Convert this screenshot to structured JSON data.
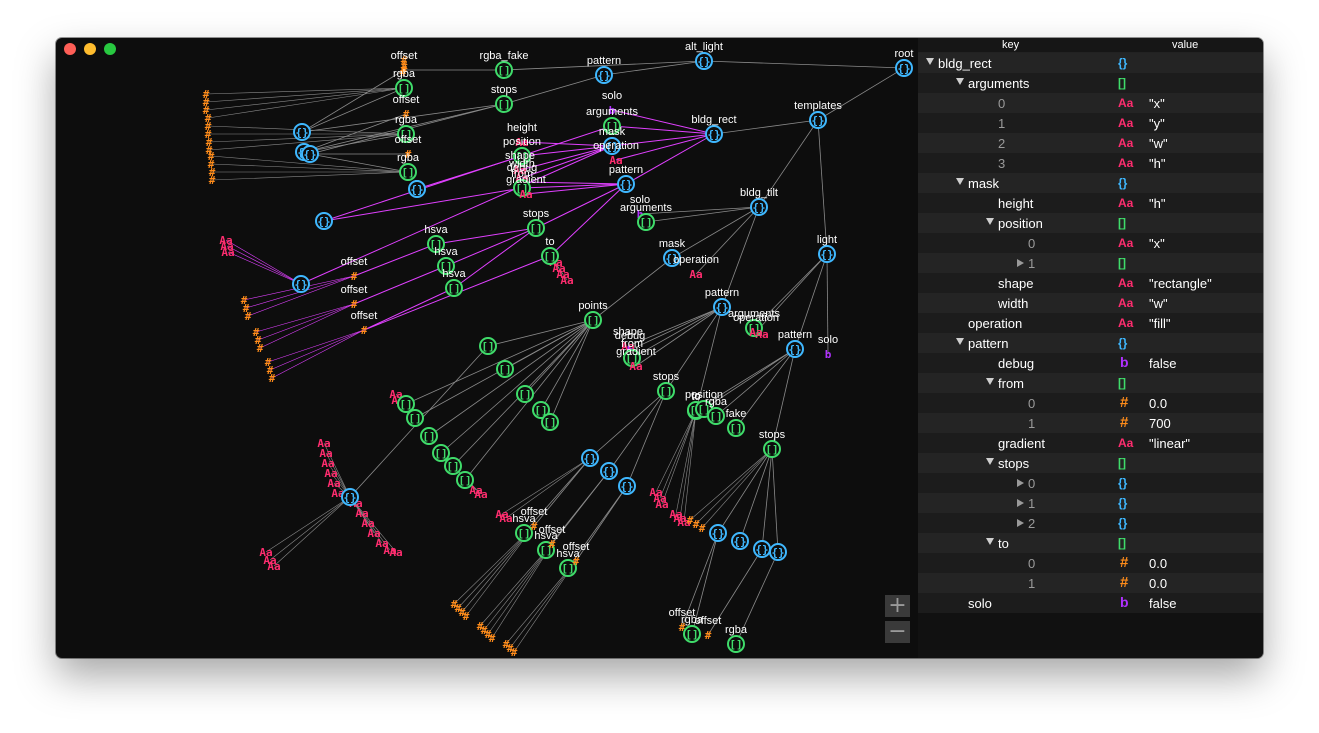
{
  "colors": {
    "object": "#3fb8ff",
    "array": "#3fdc6a",
    "string": "#ff2d6f",
    "number": "#ff8c1a",
    "boolean": "#b030ff",
    "edge": "#8a8a8a",
    "highlight_edge": "#e040ff"
  },
  "zoom": {
    "in_label": "+",
    "out_label": "−"
  },
  "inspector": {
    "key_header": "key",
    "value_header": "value",
    "rows": [
      {
        "key": "bldg_rect",
        "depth": 0,
        "toggle": "open",
        "type": "object",
        "value": ""
      },
      {
        "key": "arguments",
        "depth": 1,
        "toggle": "open",
        "type": "array",
        "value": ""
      },
      {
        "key": "0",
        "depth": 2,
        "toggle": "none",
        "type": "string",
        "value": "\"x\"",
        "index": true
      },
      {
        "key": "1",
        "depth": 2,
        "toggle": "none",
        "type": "string",
        "value": "\"y\"",
        "index": true
      },
      {
        "key": "2",
        "depth": 2,
        "toggle": "none",
        "type": "string",
        "value": "\"w\"",
        "index": true
      },
      {
        "key": "3",
        "depth": 2,
        "toggle": "none",
        "type": "string",
        "value": "\"h\"",
        "index": true
      },
      {
        "key": "mask",
        "depth": 1,
        "toggle": "open",
        "type": "object",
        "value": ""
      },
      {
        "key": "height",
        "depth": 2,
        "toggle": "none",
        "type": "string",
        "value": "\"h\""
      },
      {
        "key": "position",
        "depth": 2,
        "toggle": "open",
        "type": "array",
        "value": ""
      },
      {
        "key": "0",
        "depth": 3,
        "toggle": "none",
        "type": "string",
        "value": "\"x\"",
        "index": true
      },
      {
        "key": "1",
        "depth": 3,
        "toggle": "closed",
        "type": "array",
        "value": "",
        "index": true
      },
      {
        "key": "shape",
        "depth": 2,
        "toggle": "none",
        "type": "string",
        "value": "\"rectangle\""
      },
      {
        "key": "width",
        "depth": 2,
        "toggle": "none",
        "type": "string",
        "value": "\"w\""
      },
      {
        "key": "operation",
        "depth": 1,
        "toggle": "none",
        "type": "string",
        "value": "\"fill\""
      },
      {
        "key": "pattern",
        "depth": 1,
        "toggle": "open",
        "type": "object",
        "value": ""
      },
      {
        "key": "debug",
        "depth": 2,
        "toggle": "none",
        "type": "boolean",
        "value": "false"
      },
      {
        "key": "from",
        "depth": 2,
        "toggle": "open",
        "type": "array",
        "value": ""
      },
      {
        "key": "0",
        "depth": 3,
        "toggle": "none",
        "type": "number",
        "value": "0.0",
        "index": true
      },
      {
        "key": "1",
        "depth": 3,
        "toggle": "none",
        "type": "number",
        "value": "700",
        "index": true
      },
      {
        "key": "gradient",
        "depth": 2,
        "toggle": "none",
        "type": "string",
        "value": "\"linear\""
      },
      {
        "key": "stops",
        "depth": 2,
        "toggle": "open",
        "type": "array",
        "value": ""
      },
      {
        "key": "0",
        "depth": 3,
        "toggle": "closed",
        "type": "object",
        "value": "",
        "index": true
      },
      {
        "key": "1",
        "depth": 3,
        "toggle": "closed",
        "type": "object",
        "value": "",
        "index": true
      },
      {
        "key": "2",
        "depth": 3,
        "toggle": "closed",
        "type": "object",
        "value": "",
        "index": true
      },
      {
        "key": "to",
        "depth": 2,
        "toggle": "open",
        "type": "array",
        "value": ""
      },
      {
        "key": "0",
        "depth": 3,
        "toggle": "none",
        "type": "number",
        "value": "0.0",
        "index": true
      },
      {
        "key": "1",
        "depth": 3,
        "toggle": "none",
        "type": "number",
        "value": "0.0",
        "index": true
      },
      {
        "key": "solo",
        "depth": 1,
        "toggle": "none",
        "type": "boolean",
        "value": "false"
      }
    ]
  },
  "type_glyphs": {
    "object": "{}",
    "array": "[]",
    "string": "Aa",
    "number": "#",
    "boolean": "b"
  },
  "graph": {
    "nodes": [
      {
        "id": "root",
        "label": "root",
        "type": "object"
      },
      {
        "id": "templates",
        "label": "templates",
        "type": "object"
      },
      {
        "id": "alt_light",
        "label": "alt_light",
        "type": "object"
      },
      {
        "id": "bldg_rect",
        "label": "bldg_rect",
        "type": "object"
      },
      {
        "id": "bldg_tilt",
        "label": "bldg_tilt",
        "type": "object"
      },
      {
        "id": "light",
        "label": "light",
        "type": "object"
      },
      {
        "id": "p_top",
        "label": "pattern",
        "type": "object"
      },
      {
        "id": "stops_top",
        "label": "stops",
        "type": "array"
      },
      {
        "id": "rgba_fake",
        "label": "rgba_fake",
        "type": "array"
      },
      {
        "id": "offset_a",
        "label": "offset",
        "type": "number"
      },
      {
        "id": "rgba_a",
        "label": "rgba",
        "type": "array"
      },
      {
        "id": "offset_b",
        "label": "offset",
        "type": "number"
      },
      {
        "id": "rgba_b",
        "label": "rgba",
        "type": "array"
      },
      {
        "id": "offset_c",
        "label": "offset",
        "type": "number"
      },
      {
        "id": "rgba_c",
        "label": "rgba",
        "type": "array"
      },
      {
        "id": "s0",
        "label": "",
        "type": "object"
      },
      {
        "id": "s1",
        "label": "",
        "type": "object"
      },
      {
        "id": "s2",
        "label": "",
        "type": "object"
      },
      {
        "id": "solo_r",
        "label": "solo",
        "type": "boolean"
      },
      {
        "id": "args_r",
        "label": "arguments",
        "type": "array"
      },
      {
        "id": "mask_r",
        "label": "mask",
        "type": "object"
      },
      {
        "id": "operation_r",
        "label": "operation",
        "type": "string"
      },
      {
        "id": "height_r",
        "label": "height",
        "type": "string"
      },
      {
        "id": "position_r",
        "label": "position",
        "type": "array"
      },
      {
        "id": "shape_r",
        "label": "shape",
        "type": "string"
      },
      {
        "id": "width_r",
        "label": "width",
        "type": "string"
      },
      {
        "id": "debug_r",
        "label": "debug",
        "type": "boolean"
      },
      {
        "id": "from_r",
        "label": "from",
        "type": "array"
      },
      {
        "id": "gradient_r",
        "label": "gradient",
        "type": "string"
      },
      {
        "id": "pattern_r",
        "label": "pattern",
        "type": "object"
      },
      {
        "id": "stops_r",
        "label": "stops",
        "type": "array"
      },
      {
        "id": "to_r",
        "label": "to",
        "type": "array"
      },
      {
        "id": "rs0",
        "label": "",
        "type": "object"
      },
      {
        "id": "rs1",
        "label": "",
        "type": "object"
      },
      {
        "id": "rs2",
        "label": "",
        "type": "object"
      },
      {
        "id": "hsva_1",
        "label": "hsva",
        "type": "array"
      },
      {
        "id": "offset_1",
        "label": "offset",
        "type": "number"
      },
      {
        "id": "hsva_2",
        "label": "hsva",
        "type": "array"
      },
      {
        "id": "offset_2",
        "label": "offset",
        "type": "number"
      },
      {
        "id": "hsva_3",
        "label": "hsva",
        "type": "array"
      },
      {
        "id": "offset_3",
        "label": "offset",
        "type": "number"
      },
      {
        "id": "solo_t",
        "label": "solo",
        "type": "boolean"
      },
      {
        "id": "args_t",
        "label": "arguments",
        "type": "array"
      },
      {
        "id": "mask_t",
        "label": "mask",
        "type": "object"
      },
      {
        "id": "operation_t",
        "label": "operation",
        "type": "string"
      },
      {
        "id": "pattern_t",
        "label": "pattern",
        "type": "object"
      },
      {
        "id": "points",
        "label": "points",
        "type": "array"
      },
      {
        "id": "shape_t",
        "label": "shape",
        "type": "string"
      },
      {
        "id": "debug_t",
        "label": "debug",
        "type": "boolean"
      },
      {
        "id": "from_t",
        "label": "from",
        "type": "array"
      },
      {
        "id": "gradient_t",
        "label": "gradient",
        "type": "string"
      },
      {
        "id": "stops_t",
        "label": "stops",
        "type": "array"
      },
      {
        "id": "to_t",
        "label": "to",
        "type": "array"
      },
      {
        "id": "pt0",
        "label": "",
        "type": "array"
      },
      {
        "id": "pt1",
        "label": "",
        "type": "array"
      },
      {
        "id": "pt2",
        "label": "",
        "type": "array"
      },
      {
        "id": "pt3",
        "label": "",
        "type": "array"
      },
      {
        "id": "pt4",
        "label": "",
        "type": "array"
      },
      {
        "id": "pt5",
        "label": "",
        "type": "array"
      },
      {
        "id": "pt6",
        "label": "",
        "type": "array"
      },
      {
        "id": "pt7",
        "label": "",
        "type": "array"
      },
      {
        "id": "pt8",
        "label": "",
        "type": "array"
      },
      {
        "id": "pt9",
        "label": "",
        "type": "array"
      },
      {
        "id": "pt10",
        "label": "",
        "type": "array"
      },
      {
        "id": "ts0",
        "label": "",
        "type": "object"
      },
      {
        "id": "ts1",
        "label": "",
        "type": "object"
      },
      {
        "id": "ts2",
        "label": "",
        "type": "object"
      },
      {
        "id": "ts3",
        "label": "",
        "type": "object"
      },
      {
        "id": "hsva_t1",
        "label": "hsva",
        "type": "array"
      },
      {
        "id": "offset_t1",
        "label": "offset",
        "type": "number"
      },
      {
        "id": "hsva_t2",
        "label": "hsva",
        "type": "array"
      },
      {
        "id": "offset_t2",
        "label": "offset",
        "type": "number"
      },
      {
        "id": "hsva_t3",
        "label": "hsva",
        "type": "array"
      },
      {
        "id": "offset_t3",
        "label": "offset",
        "type": "number"
      },
      {
        "id": "args_l",
        "label": "arguments",
        "type": "array"
      },
      {
        "id": "operation_l",
        "label": "operation",
        "type": "string"
      },
      {
        "id": "pattern_l",
        "label": "pattern",
        "type": "object"
      },
      {
        "id": "solo_l",
        "label": "solo",
        "type": "boolean"
      },
      {
        "id": "to_l",
        "label": "to",
        "type": "array"
      },
      {
        "id": "position_l",
        "label": "position",
        "type": "array"
      },
      {
        "id": "rgba_l",
        "label": "rgba",
        "type": "array"
      },
      {
        "id": "fake_l",
        "label": "fake",
        "type": "array"
      },
      {
        "id": "stops_l",
        "label": "stops",
        "type": "array"
      },
      {
        "id": "ls0",
        "label": "",
        "type": "object"
      },
      {
        "id": "ls1",
        "label": "",
        "type": "object"
      },
      {
        "id": "ls2",
        "label": "",
        "type": "object"
      },
      {
        "id": "ls3",
        "label": "",
        "type": "object"
      },
      {
        "id": "offset_l1",
        "label": "offset",
        "type": "number"
      },
      {
        "id": "rgba_l1",
        "label": "rgba",
        "type": "array"
      },
      {
        "id": "offset_l2",
        "label": "offset",
        "type": "number"
      },
      {
        "id": "rgba_l2",
        "label": "rgba",
        "type": "array"
      }
    ]
  }
}
